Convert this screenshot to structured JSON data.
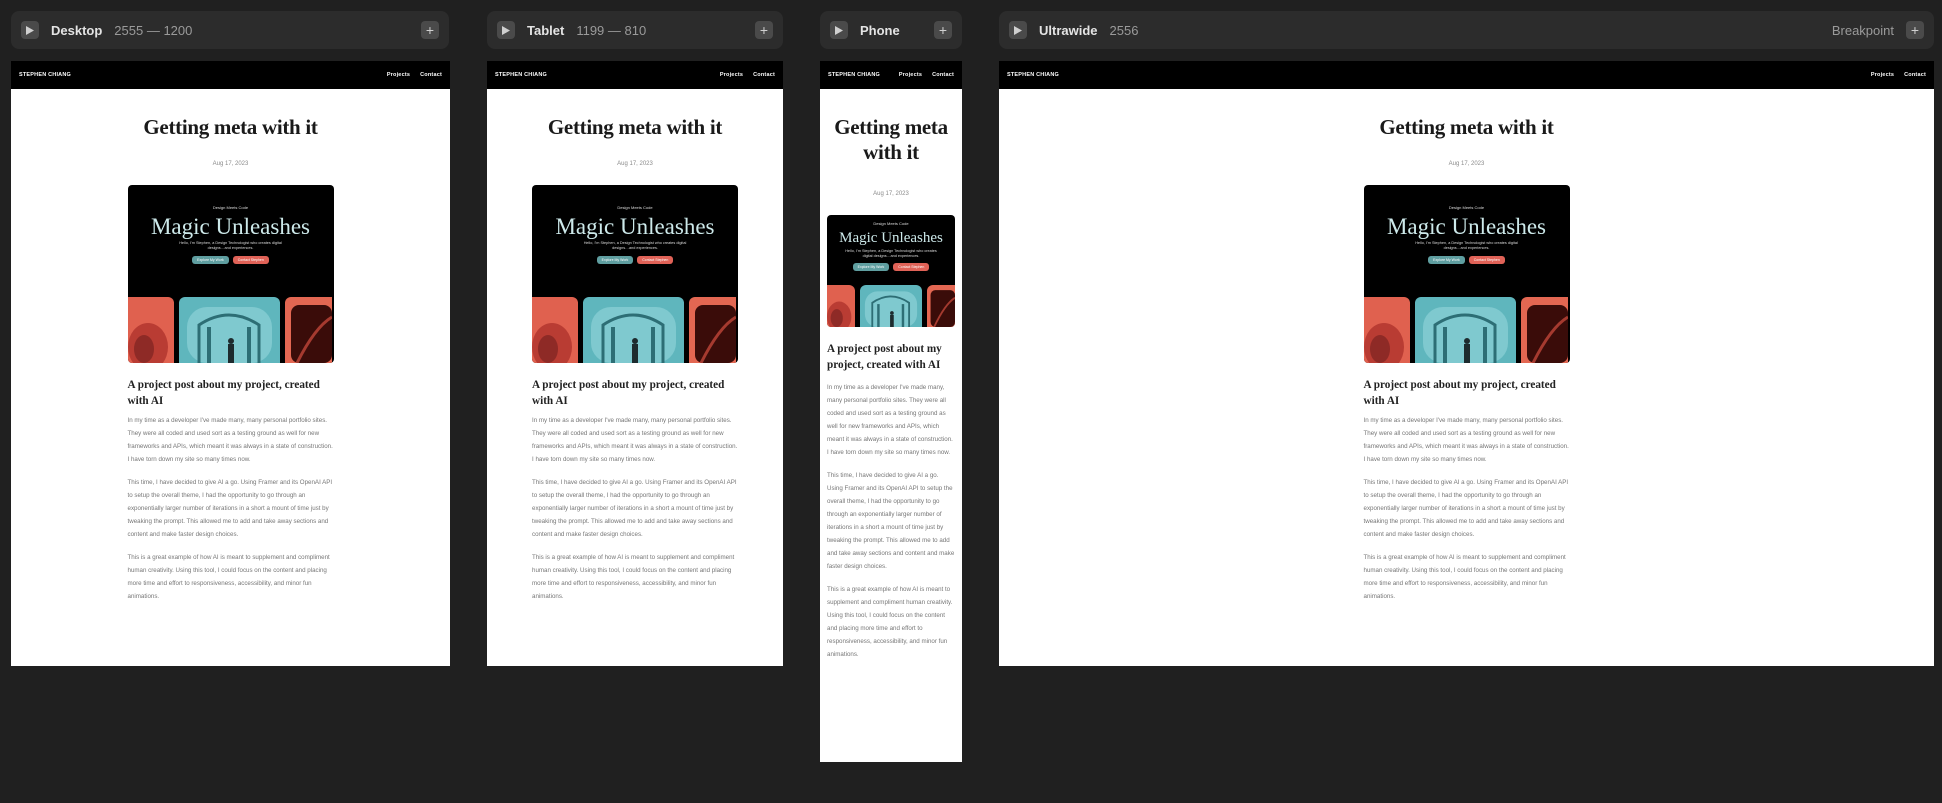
{
  "toolbar": {
    "desktop": {
      "name": "Desktop",
      "size": "2555 — 1200"
    },
    "tablet": {
      "name": "Tablet",
      "size": "1199 — 810"
    },
    "phone": {
      "name": "Phone"
    },
    "ultrawide": {
      "name": "Ultrawide",
      "size": "2556"
    },
    "breakpoint_label": "Breakpoint",
    "add_symbol": "+"
  },
  "site": {
    "brand": "STEPHEN CHIANG",
    "nav": [
      "Projects",
      "Contact"
    ],
    "title": "Getting meta with it",
    "date": "Aug 17, 2023",
    "hero": {
      "eyebrow": "Design Meets Code",
      "heading": "Magic Unleashes",
      "subtitle": "Hello, I'm Stephen, a Design Technologist who creates digital designs…and experiences.",
      "button_primary": "Explore My Work",
      "button_secondary": "Contact Stephen"
    },
    "heading": "A project post about my project, created with AI",
    "paragraphs": [
      "In my time as a developer I've made many, many personal portfolio sites. They were all coded and used sort as a testing ground as well for new frameworks and APIs, which meant it was always in a state of construction. I have torn down my site so many times now.",
      "This time, I have decided to give AI a go. Using Framer and its OpenAI API to setup the overall theme, I had the opportunity to go through an exponentially larger number of iterations in a short a mount of time just by tweaking the prompt. This allowed me to add and take away sections and content and make faster design choices.",
      "This is a great example of how AI is meant to supplement and compliment human creativity. Using this tool, I could focus on the content and placing more time and effort to responsiveness, accessibility, and minor fun animations."
    ]
  },
  "colors": {
    "canvas": "#202020",
    "toolbar": "#2c2c2c",
    "nav": "#000000",
    "teal": "#5fb6bd",
    "coral": "#e0614f"
  }
}
